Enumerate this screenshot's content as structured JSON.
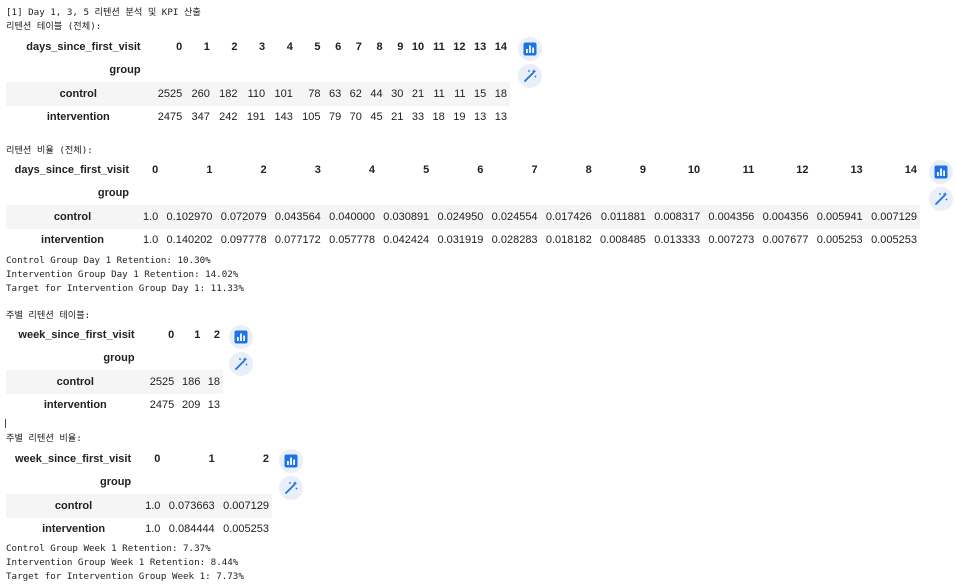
{
  "output_lines": {
    "header": "[1] Day 1, 3, 5 리텐션 분석 및 KPI 산출",
    "retention_table_title": "리텐션 테이블 (전체):",
    "retention_rate_title": "리텐션 비율 (전체):",
    "day_summary": [
      "Control Group Day 1 Retention: 10.30%",
      "Intervention Group Day 1 Retention: 14.02%",
      "Target for Intervention Group Day 1: 11.33%"
    ],
    "weekly_table_title": "주별 리텐션 테이블:",
    "weekly_rate_title": "주별 리텐션 비율:",
    "week_summary": [
      "Control Group Week 1 Retention: 7.37%",
      "Intervention Group Week 1 Retention: 8.44%",
      "Target for Intervention Group Week 1: 7.73%"
    ]
  },
  "tables": {
    "daily_counts": {
      "column_axis": "days_since_first_visit",
      "index_name": "group",
      "columns": [
        "0",
        "1",
        "2",
        "3",
        "4",
        "5",
        "6",
        "7",
        "8",
        "9",
        "10",
        "11",
        "12",
        "13",
        "14"
      ],
      "rows": [
        {
          "label": "control",
          "values": [
            "2525",
            "260",
            "182",
            "110",
            "101",
            "78",
            "63",
            "62",
            "44",
            "30",
            "21",
            "11",
            "11",
            "15",
            "18"
          ]
        },
        {
          "label": "intervention",
          "values": [
            "2475",
            "347",
            "242",
            "191",
            "143",
            "105",
            "79",
            "70",
            "45",
            "21",
            "33",
            "18",
            "19",
            "13",
            "13"
          ]
        }
      ]
    },
    "daily_rates": {
      "column_axis": "days_since_first_visit",
      "index_name": "group",
      "columns": [
        "0",
        "1",
        "2",
        "3",
        "4",
        "5",
        "6",
        "7",
        "8",
        "9",
        "10",
        "11",
        "12",
        "13",
        "14"
      ],
      "rows": [
        {
          "label": "control",
          "values": [
            "1.0",
            "0.102970",
            "0.072079",
            "0.043564",
            "0.040000",
            "0.030891",
            "0.024950",
            "0.024554",
            "0.017426",
            "0.011881",
            "0.008317",
            "0.004356",
            "0.004356",
            "0.005941",
            "0.007129"
          ]
        },
        {
          "label": "intervention",
          "values": [
            "1.0",
            "0.140202",
            "0.097778",
            "0.077172",
            "0.057778",
            "0.042424",
            "0.031919",
            "0.028283",
            "0.018182",
            "0.008485",
            "0.013333",
            "0.007273",
            "0.007677",
            "0.005253",
            "0.005253"
          ]
        }
      ]
    },
    "weekly_counts": {
      "column_axis": "week_since_first_visit",
      "index_name": "group",
      "columns": [
        "0",
        "1",
        "2"
      ],
      "rows": [
        {
          "label": "control",
          "values": [
            "2525",
            "186",
            "18"
          ]
        },
        {
          "label": "intervention",
          "values": [
            "2475",
            "209",
            "13"
          ]
        }
      ]
    },
    "weekly_rates": {
      "column_axis": "week_since_first_visit",
      "index_name": "group",
      "columns": [
        "0",
        "1",
        "2"
      ],
      "rows": [
        {
          "label": "control",
          "values": [
            "1.0",
            "0.073663",
            "0.007129"
          ]
        },
        {
          "label": "intervention",
          "values": [
            "1.0",
            "0.084444",
            "0.005253"
          ]
        }
      ]
    }
  },
  "icons": {
    "chart_button": "bar-chart-icon",
    "magic_button": "magic-wand-icon"
  },
  "colors": {
    "row_stripe": "#f5f5f5",
    "icon_blue": "#1a73e8",
    "icon_button_bg": "#e9eef8"
  }
}
